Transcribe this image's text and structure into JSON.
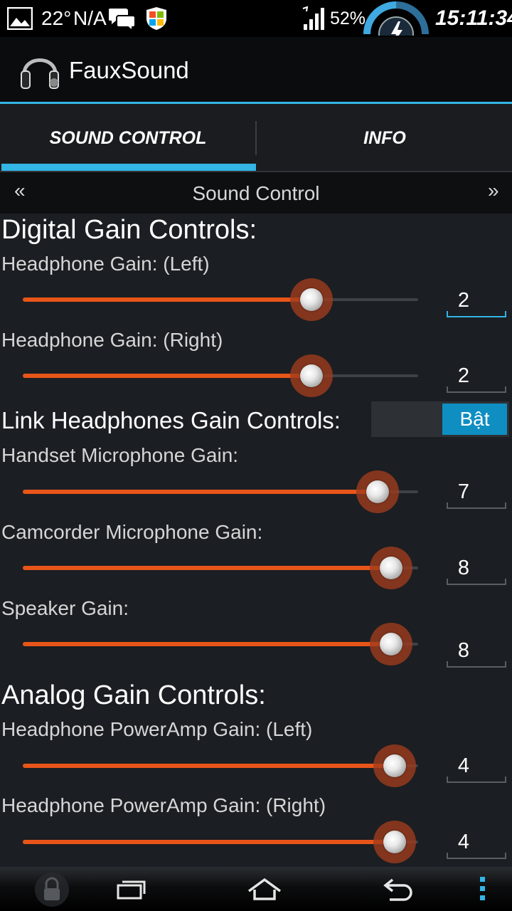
{
  "status_bar": {
    "temperature": "22°",
    "weather_status": "N/A",
    "battery_percent": "52%",
    "time": "15:11:34",
    "icons": [
      "image-icon",
      "chat-icon",
      "windows-shield-icon",
      "signal-icon",
      "battery-gauge-icon"
    ]
  },
  "action_bar": {
    "app_name": "FauxSound",
    "app_icon": "headphones-icon"
  },
  "tabs": [
    {
      "label": "SOUND CONTROL",
      "selected": true
    },
    {
      "label": "INFO",
      "selected": false
    }
  ],
  "pager": {
    "prev_arrow": "«",
    "title": "Sound Control",
    "next_arrow": "»"
  },
  "digital": {
    "title": "Digital Gain Controls:",
    "headphone_left": {
      "label": "Headphone Gain: (Left)",
      "value": "2",
      "fill_fraction": 0.73
    },
    "headphone_right": {
      "label": "Headphone Gain: (Right)",
      "value": "2",
      "fill_fraction": 0.73
    },
    "link": {
      "label": "Link Headphones Gain Controls:",
      "toggle_label": "Bật",
      "on": true
    },
    "handset_mic": {
      "label": "Handset Microphone Gain:",
      "value": "7",
      "fill_fraction": 0.897
    },
    "camcorder_mic": {
      "label": "Camcorder Microphone Gain:",
      "value": "8",
      "fill_fraction": 0.932
    },
    "speaker": {
      "label": "Speaker Gain:",
      "value": "8",
      "fill_fraction": 0.932
    }
  },
  "analog": {
    "title": "Analog Gain Controls:",
    "poweramp_left": {
      "label": "Headphone PowerAmp Gain: (Left)",
      "value": "4",
      "fill_fraction": 0.94
    },
    "poweramp_right": {
      "label": "Headphone PowerAmp Gain: (Right)",
      "value": "4",
      "fill_fraction": 0.94
    }
  },
  "nav_bar": {
    "icons": [
      "lock-icon",
      "recent-apps-icon",
      "home-icon",
      "back-icon",
      "overflow-menu-icon"
    ]
  },
  "colors": {
    "accent_blue": "#33b5e5",
    "slider_orange": "#e85519",
    "toggle_blue": "#0f8ec2"
  }
}
